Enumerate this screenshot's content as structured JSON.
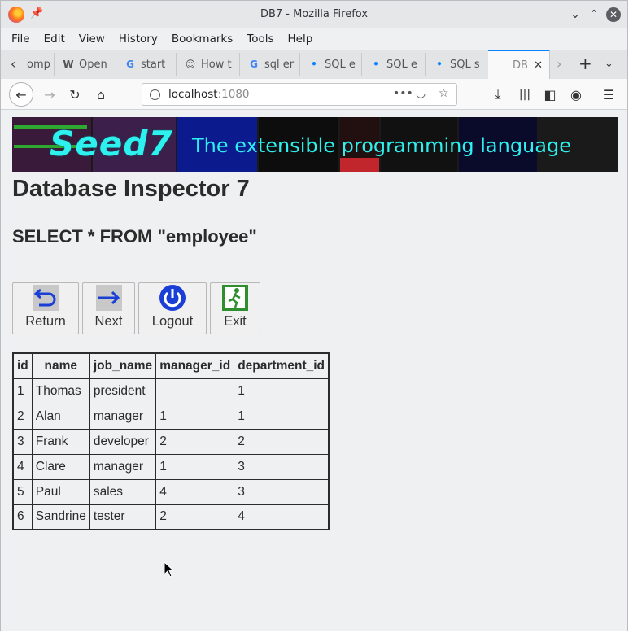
{
  "window": {
    "title": "DB7 - Mozilla Firefox"
  },
  "menu": [
    "File",
    "Edit",
    "View",
    "History",
    "Bookmarks",
    "Tools",
    "Help"
  ],
  "tabs": [
    {
      "label": "omp",
      "icon": ""
    },
    {
      "label": "Open",
      "icon": "W"
    },
    {
      "label": "start",
      "icon": "G"
    },
    {
      "label": "How t",
      "icon": "☺"
    },
    {
      "label": "sql er",
      "icon": "G"
    },
    {
      "label": "SQL e",
      "icon": "•"
    },
    {
      "label": "SQL e",
      "icon": "•"
    },
    {
      "label": "SQL s",
      "icon": "•"
    },
    {
      "label": "DB",
      "icon": ""
    }
  ],
  "url": {
    "host": "localhost",
    "port": ":1080"
  },
  "banner": {
    "logo": "Seed7",
    "tagline": "The extensible programming language"
  },
  "page": {
    "title": "Database Inspector 7",
    "query": "SELECT * FROM \"employee\""
  },
  "buttons": [
    {
      "label": "Return",
      "icon": "return-arrow-icon"
    },
    {
      "label": "Next",
      "icon": "next-arrow-icon"
    },
    {
      "label": "Logout",
      "icon": "power-icon"
    },
    {
      "label": "Exit",
      "icon": "exit-door-icon"
    }
  ],
  "table": {
    "columns": [
      "id",
      "name",
      "job_name",
      "manager_id",
      "department_id"
    ],
    "rows": [
      [
        "1",
        "Thomas",
        "president",
        "",
        "1"
      ],
      [
        "2",
        "Alan",
        "manager",
        "1",
        "1"
      ],
      [
        "3",
        "Frank",
        "developer",
        "2",
        "2"
      ],
      [
        "4",
        "Clare",
        "manager",
        "1",
        "3"
      ],
      [
        "5",
        "Paul",
        "sales",
        "4",
        "3"
      ],
      [
        "6",
        "Sandrine",
        "tester",
        "2",
        "4"
      ]
    ]
  },
  "colors": {
    "accent": "#0a84ff",
    "banner_text": "#2ef0ee",
    "logout_blue": "#1a3fd6",
    "exit_green": "#2f8f2f"
  }
}
